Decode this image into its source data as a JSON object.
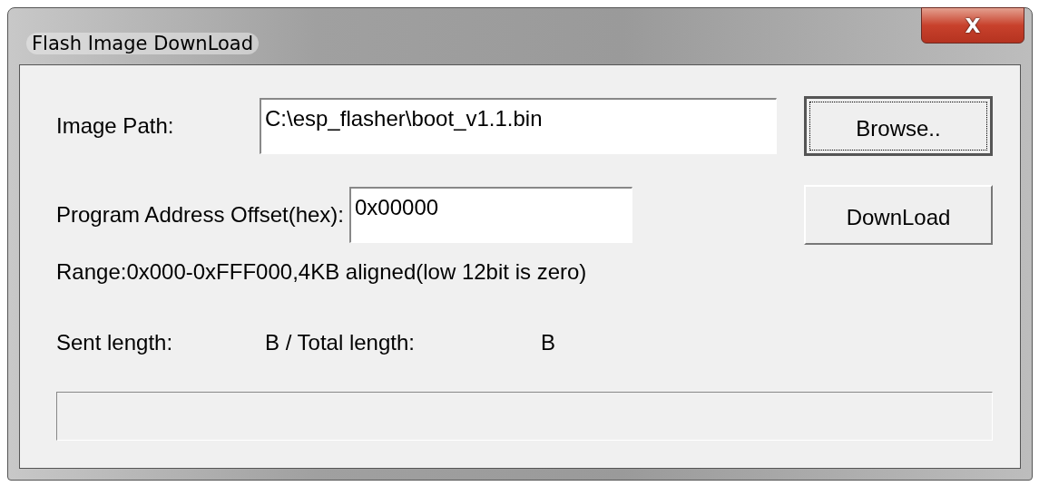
{
  "window": {
    "title": "Flash Image DownLoad",
    "close": "X"
  },
  "image_path": {
    "label": "Image Path:",
    "value": "C:\\esp_flasher\\boot_v1.1.bin"
  },
  "browse_button": {
    "label": "Browse..",
    "focused": true
  },
  "offset": {
    "label": "Program Address Offset(hex):",
    "value": "0x00000"
  },
  "download_button": {
    "label": "DownLoad",
    "focused": false
  },
  "range_note": "Range:0x000-0xFFF000,4KB aligned(low 12bit is zero)",
  "length_line": [
    "Sent length:",
    "B / Total length:",
    "B"
  ],
  "progress": {
    "level": 0
  }
}
